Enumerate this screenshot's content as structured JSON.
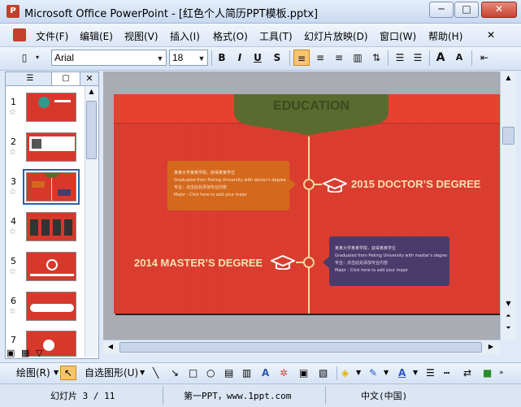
{
  "window": {
    "title": "Microsoft Office PowerPoint - [红色个人简历PPT模板.pptx]",
    "app_icon": "P",
    "controls": {
      "minimize": "─",
      "maximize": "□",
      "close": "✕"
    }
  },
  "menu": {
    "icon": "powerpoint-doc-icon",
    "items": [
      "文件(F)",
      "编辑(E)",
      "视图(V)",
      "插入(I)",
      "格式(O)",
      "工具(T)",
      "幻灯片放映(D)",
      "窗口(W)",
      "帮助(H)"
    ]
  },
  "toolbar": {
    "font_name": "Arial",
    "font_size": "18",
    "bold": "B",
    "italic": "I",
    "underline": "U",
    "shadow": "S",
    "increase_font": "A",
    "decrease_font": "A"
  },
  "slides_pane": {
    "numbers": [
      "1",
      "2",
      "3",
      "4",
      "5",
      "6",
      "7"
    ],
    "selected": "3"
  },
  "slide": {
    "header": "EDUCATION",
    "entries": [
      {
        "heading": "2015 DOCTOR’S DEGREE",
        "line1": "某某大学某某学院，获得某某学位",
        "line2": "Graduated from Peking University with doctor's degree",
        "line3": "专业：点击此处添加专业内容",
        "line4": "Major : Click here to add your major"
      },
      {
        "heading": "2014 MASTER’S DEGREE",
        "line1": "某某大学某某学院，获得某某学位",
        "line2": "Graduated from Peking University with master's degree",
        "line3": "专业：点击此处添加专业内容",
        "line4": "Major : Click here to add your major"
      }
    ]
  },
  "drawbar": {
    "draw": "绘图(R)",
    "autoshapes": "自选图形(U)"
  },
  "status": {
    "slide_info": "幻灯片 3 / 11",
    "template": "第一PPT，www.1ppt.com",
    "language": "中文(中国)"
  },
  "colors": {
    "slide_red": "#d93c2e",
    "header_green": "#5a6b2f",
    "orange_box": "#d4691d",
    "purple_box": "#4b3b6a",
    "timeline": "#f5d79a"
  }
}
